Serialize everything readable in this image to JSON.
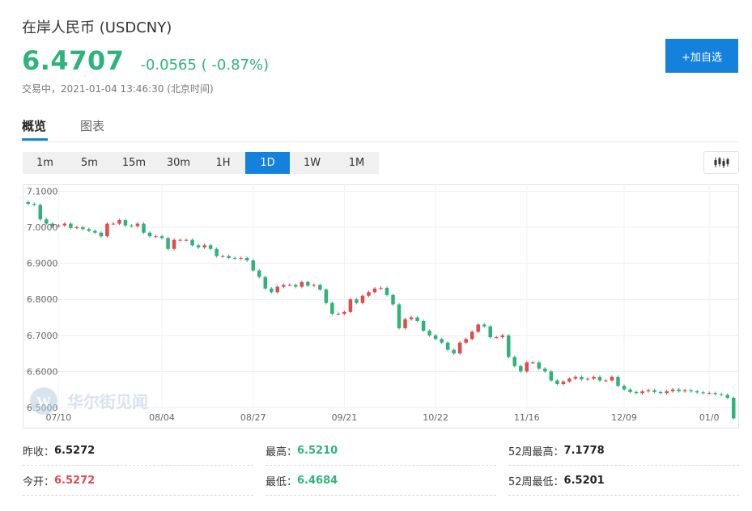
{
  "header": {
    "title": "在岸人民币 (USDCNY)",
    "price": "6.4707",
    "change": "-0.0565 ( -0.87%)",
    "status": "交易中，2021-01-04 13:46:30 (北京时间)",
    "add_button": "+加自选"
  },
  "tabs": [
    {
      "label": "概览",
      "active": true
    },
    {
      "label": "图表",
      "active": false
    }
  ],
  "periods": [
    {
      "label": "1m",
      "active": false
    },
    {
      "label": "5m",
      "active": false
    },
    {
      "label": "15m",
      "active": false
    },
    {
      "label": "30m",
      "active": false
    },
    {
      "label": "1H",
      "active": false
    },
    {
      "label": "1D",
      "active": true
    },
    {
      "label": "1W",
      "active": false
    },
    {
      "label": "1M",
      "active": false
    }
  ],
  "icons": {
    "chart_type": "candlestick-icon"
  },
  "colors": {
    "up": "#e04b4b",
    "down": "#2eb37a",
    "accent": "#1482dc"
  },
  "watermark": "华尔街见闻",
  "chart_data": {
    "type": "candlestick",
    "ylim": [
      6.5,
      7.11
    ],
    "y_ticks": [
      "7.1000",
      "7.0000",
      "6.9000",
      "6.8000",
      "6.7000",
      "6.6000",
      "6.5000"
    ],
    "y_tick_values": [
      7.1,
      7.0,
      6.9,
      6.8,
      6.7,
      6.6,
      6.5
    ],
    "x_ticks": [
      "07/10",
      "08/04",
      "08/27",
      "09/21",
      "10/22",
      "11/16",
      "12/09",
      "01/0"
    ],
    "grid": true,
    "closes": [
      7.065,
      7.062,
      7.022,
      7.01,
      7.003,
      7.005,
      7.01,
      6.998,
      7.0,
      6.995,
      6.99,
      6.985,
      6.975,
      7.01,
      7.01,
      7.02,
      7.005,
      7.003,
      7.01,
      6.985,
      6.975,
      6.975,
      6.97,
      6.94,
      6.965,
      6.965,
      6.965,
      6.95,
      6.944,
      6.95,
      6.94,
      6.92,
      6.92,
      6.915,
      6.913,
      6.915,
      6.908,
      6.88,
      6.862,
      6.83,
      6.82,
      6.835,
      6.84,
      6.84,
      6.835,
      6.848,
      6.838,
      6.84,
      6.827,
      6.79,
      6.76,
      6.76,
      6.765,
      6.8,
      6.79,
      6.81,
      6.82,
      6.83,
      6.832,
      6.812,
      6.786,
      6.72,
      6.745,
      6.75,
      6.74,
      6.713,
      6.7,
      6.69,
      6.68,
      6.66,
      6.65,
      6.68,
      6.69,
      6.71,
      6.73,
      6.725,
      6.695,
      6.695,
      6.7,
      6.64,
      6.615,
      6.6,
      6.625,
      6.625,
      6.608,
      6.6,
      6.575,
      6.565,
      6.572,
      6.58,
      6.585,
      6.578,
      6.58,
      6.585,
      6.575,
      6.575,
      6.585,
      6.56,
      6.55,
      6.543,
      6.54,
      6.545,
      6.548,
      6.543,
      6.54,
      6.545,
      6.55,
      6.545,
      6.548,
      6.545,
      6.542,
      6.54,
      6.54,
      6.537,
      6.535,
      6.527,
      6.47
    ]
  },
  "stats": [
    [
      {
        "label": "昨收：",
        "value": "6.5272",
        "tone": "neutral"
      },
      {
        "label": "最高：",
        "value": "6.5210",
        "tone": "down"
      },
      {
        "label": "52周最高：",
        "value": "7.1778",
        "tone": "neutral"
      }
    ],
    [
      {
        "label": "今开：",
        "value": "6.5272",
        "tone": "up"
      },
      {
        "label": "最低：",
        "value": "6.4684",
        "tone": "down"
      },
      {
        "label": "52周最低：",
        "value": "6.5201",
        "tone": "neutral"
      }
    ]
  ]
}
